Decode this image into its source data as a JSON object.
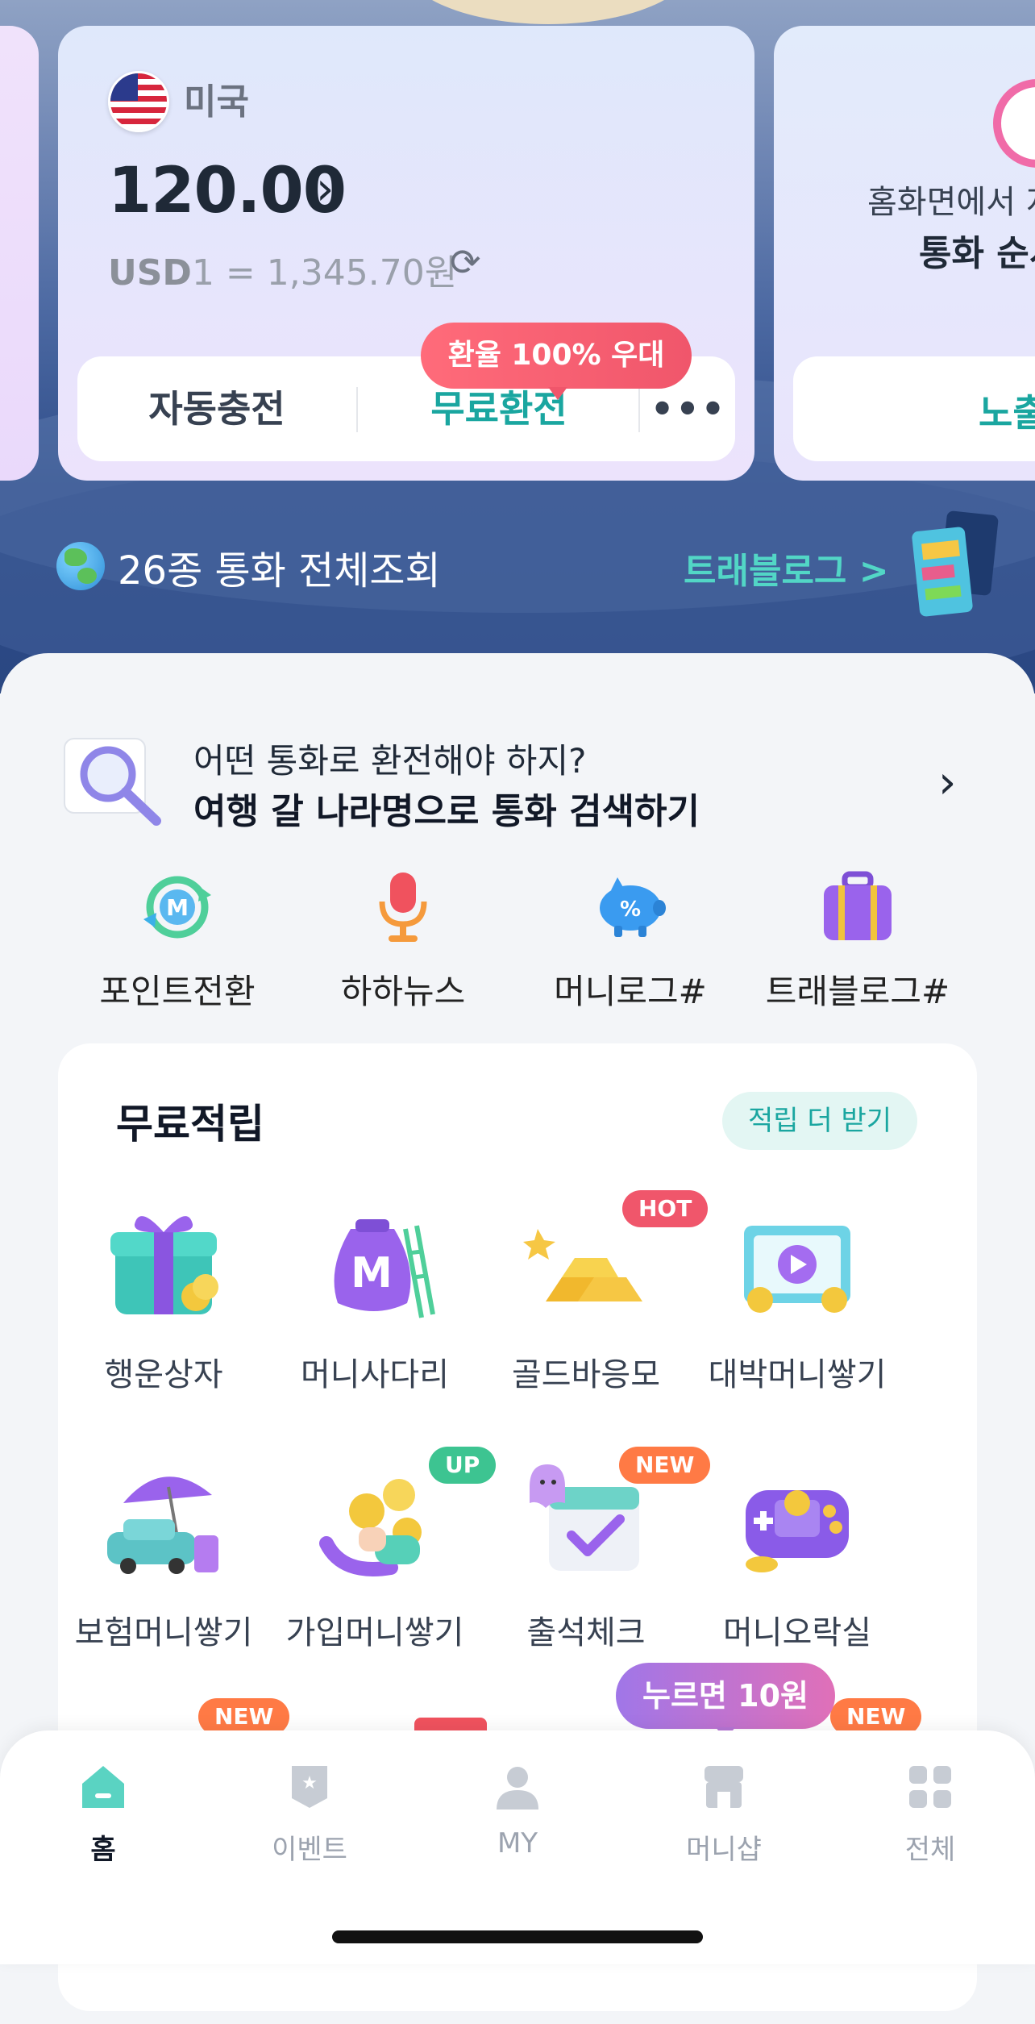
{
  "account_card": {
    "country": "미국",
    "amount": "120.00",
    "rate_code": "USD",
    "rate_text": "1 = 1,345.70원",
    "promo_bubble": "환율 100% 우대",
    "buttons": {
      "auto_charge": "자동충전",
      "free_exchange": "무료환전",
      "more": "•••"
    }
  },
  "next_card": {
    "line1": "홈화면에서 지",
    "line2": "통화 순서",
    "button": "노출"
  },
  "hero_links": {
    "all_currencies": "26종 통화 전체조회",
    "travelog": "트래블로그 >"
  },
  "search_prompt": {
    "question": "어떤 통화로 환전해야 하지?",
    "action": "여행 갈 나라명으로 통화 검색하기"
  },
  "quick_menu": [
    {
      "label": "포인트전환",
      "icon": "point-exchange-icon"
    },
    {
      "label": "하하뉴스",
      "icon": "microphone-icon"
    },
    {
      "label": "머니로그#",
      "icon": "piggy-bank-icon"
    },
    {
      "label": "트래블로그#",
      "icon": "suitcase-icon"
    }
  ],
  "free_earn": {
    "title": "무료적립",
    "more_button": "적립 더 받기",
    "items": [
      {
        "label": "행운상자",
        "icon": "gift-box-icon"
      },
      {
        "label": "머니사다리",
        "icon": "money-bag-ladder-icon"
      },
      {
        "label": "골드바응모",
        "icon": "gold-bar-icon",
        "badge": "HOT"
      },
      {
        "label": "대박머니쌓기",
        "icon": "video-coins-icon"
      },
      {
        "label": "보험머니쌓기",
        "icon": "car-umbrella-icon"
      },
      {
        "label": "가입머니쌓기",
        "icon": "coins-hand-icon",
        "badge": "UP"
      },
      {
        "label": "출석체크",
        "icon": "calendar-check-icon",
        "badge": "NEW"
      },
      {
        "label": "머니오락실",
        "icon": "game-console-icon"
      }
    ],
    "row3_badges": [
      "NEW",
      "NEW"
    ]
  },
  "tooltip": "누르면 10원",
  "tabbar": [
    {
      "label": "홈",
      "icon": "home-icon",
      "active": true
    },
    {
      "label": "이벤트",
      "icon": "event-icon"
    },
    {
      "label": "MY",
      "icon": "person-icon"
    },
    {
      "label": "머니샵",
      "icon": "shop-icon"
    },
    {
      "label": "전체",
      "icon": "grid-icon"
    }
  ],
  "colors": {
    "accent": "#1aa6a0",
    "promo": "#f0566b",
    "hero_top": "#8fa2c4",
    "hero_bottom": "#2a4782"
  }
}
